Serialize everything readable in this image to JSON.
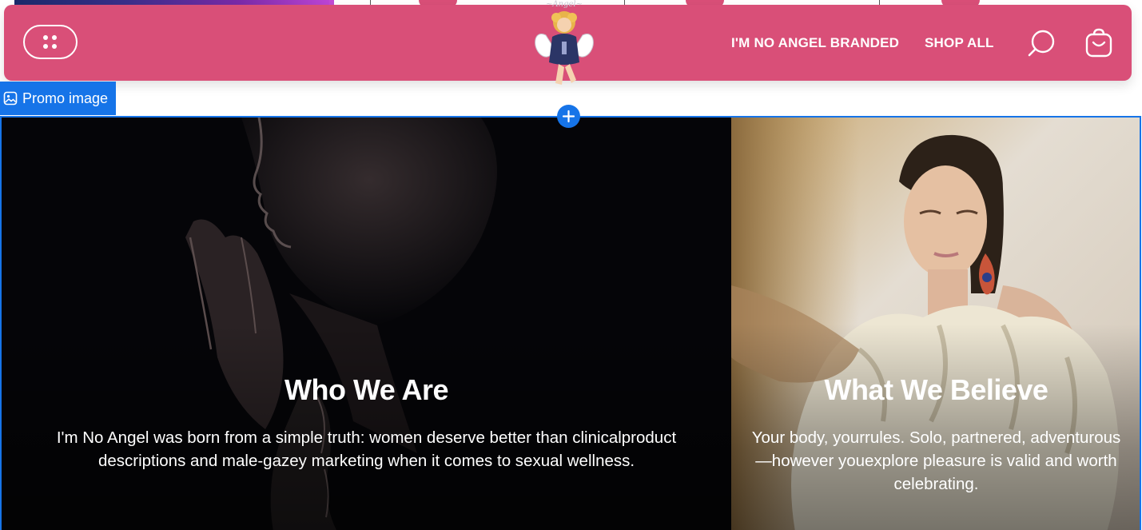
{
  "header": {
    "menu_icon": "menu-dots-icon",
    "logo_name": "angel-logo",
    "nav": [
      {
        "label": "I'M NO ANGEL BRANDED"
      },
      {
        "label": "SHOP ALL"
      }
    ],
    "search_icon": "search-icon",
    "cart_icon": "shopping-bag-icon",
    "colors": {
      "background": "#d94f78",
      "text": "#ffffff"
    }
  },
  "editor": {
    "badge_label": "Promo image",
    "badge_icon": "image-icon",
    "add_icon": "plus-icon",
    "accent": "#1674e8"
  },
  "promo": {
    "left": {
      "title": "Who We Are",
      "body": "I'm No Angel was born from a simple truth: women deserve better than clinicalproduct descriptions and male-gazey marketing when it comes to sexual wellness."
    },
    "right": {
      "title": "What We Believe",
      "body": "Your body, yourrules. Solo, partnered, adventurous—however youexplore pleasure is valid and worth celebrating."
    }
  }
}
